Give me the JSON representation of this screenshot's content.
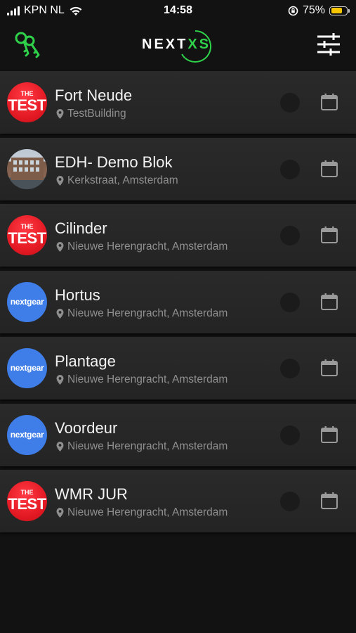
{
  "status_bar": {
    "carrier": "KPN NL",
    "time": "14:58",
    "battery_percent": "75%",
    "battery_level": 0.75,
    "battery_color": "#f7c600"
  },
  "header": {
    "logo_main": "NEXT",
    "logo_accent": "XS",
    "accent_color": "#2fd14a",
    "left_icon": "keys-icon",
    "right_icon": "filter-sliders-icon"
  },
  "locations": [
    {
      "name": "Fort Neude",
      "address": "TestBuilding",
      "avatar": "test",
      "avatar_text_small": "THE",
      "avatar_text_large": "TEST"
    },
    {
      "name": "EDH- Demo Blok",
      "address": "Kerkstraat, Amsterdam",
      "avatar": "photo"
    },
    {
      "name": "Cilinder",
      "address": "Nieuwe Herengracht, Amsterdam",
      "avatar": "test",
      "avatar_text_small": "THE",
      "avatar_text_large": "TEST"
    },
    {
      "name": "Hortus",
      "address": "Nieuwe Herengracht, Amsterdam",
      "avatar": "nextgear",
      "avatar_text": "nextgear"
    },
    {
      "name": "Plantage",
      "address": "Nieuwe Herengracht, Amsterdam",
      "avatar": "nextgear",
      "avatar_text": "nextgear"
    },
    {
      "name": "Voordeur",
      "address": "Nieuwe Herengracht, Amsterdam",
      "avatar": "nextgear",
      "avatar_text": "nextgear"
    },
    {
      "name": "WMR JUR",
      "address": "Nieuwe Herengracht, Amsterdam",
      "avatar": "test",
      "avatar_text_small": "THE",
      "avatar_text_large": "TEST"
    }
  ]
}
